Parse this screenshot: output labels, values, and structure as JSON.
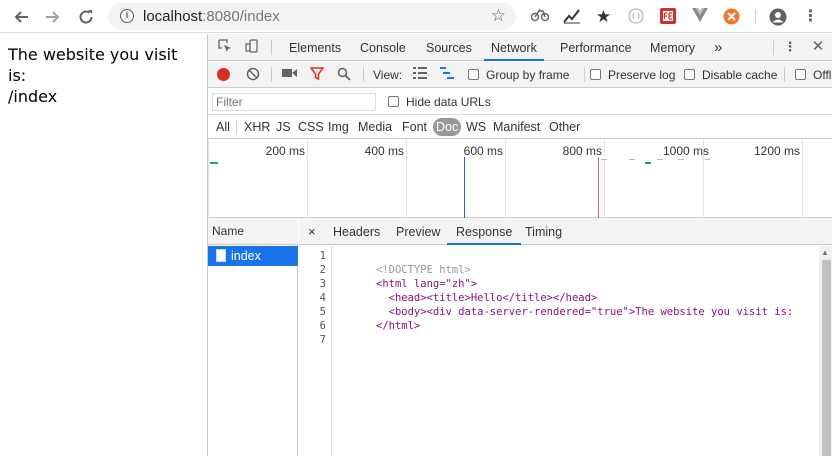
{
  "browser": {
    "url_host": "localhost",
    "url_path": ":8080/index"
  },
  "page": {
    "text_line1": "The website you visit is:",
    "text_line2": "/index"
  },
  "devtools": {
    "tabs": [
      "Elements",
      "Console",
      "Sources",
      "Network",
      "Performance",
      "Memory"
    ],
    "active_tab": "Network",
    "more_tabs": "»",
    "controls": {
      "view_label": "View:",
      "group_by_frame": "Group by frame",
      "preserve_log": "Preserve log",
      "disable_cache": "Disable cache",
      "offline": "Offl"
    },
    "filter": {
      "placeholder": "Filter",
      "hide_data_urls": "Hide data URLs"
    },
    "types": [
      "All",
      "XHR",
      "JS",
      "CSS",
      "Img",
      "Media",
      "Font",
      "Doc",
      "WS",
      "Manifest",
      "Other"
    ],
    "active_type": "Doc",
    "timeline_labels": [
      "200 ms",
      "400 ms",
      "600 ms",
      "800 ms",
      "1000 ms",
      "1200 ms"
    ],
    "name_header": "Name",
    "requests": [
      "index"
    ],
    "detail_tabs": [
      "Headers",
      "Preview",
      "Response",
      "Timing"
    ],
    "active_detail_tab": "Response",
    "close_icon": "×",
    "response_lines": [
      "",
      "<!DOCTYPE html>",
      "<html lang=\"zh\">",
      "  <head><title>Hello</title></head>",
      "  <body><div data-server-rendered=\"true\">The website you visit is:",
      "</html>",
      ""
    ]
  }
}
